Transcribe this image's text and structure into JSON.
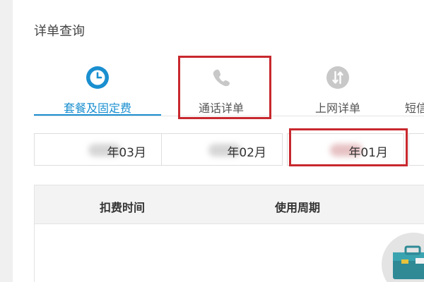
{
  "page": {
    "title": "详单查询"
  },
  "tabs": [
    {
      "label": "套餐及固定费",
      "icon": "clock-icon",
      "active": true
    },
    {
      "label": "通话详单",
      "icon": "phone-icon",
      "active": false
    },
    {
      "label": "上网详单",
      "icon": "data-transfer-icon",
      "active": false
    },
    {
      "label": "短信",
      "icon": "",
      "active": false
    }
  ],
  "months": [
    {
      "label": "年03月"
    },
    {
      "label": "年02月"
    },
    {
      "label": "年01月"
    }
  ],
  "table": {
    "headers": [
      "扣费时间",
      "使用周期"
    ]
  },
  "colors": {
    "accent": "#1a8fd0",
    "highlight": "#c8282e",
    "icon_gray": "#c8c8c8"
  }
}
